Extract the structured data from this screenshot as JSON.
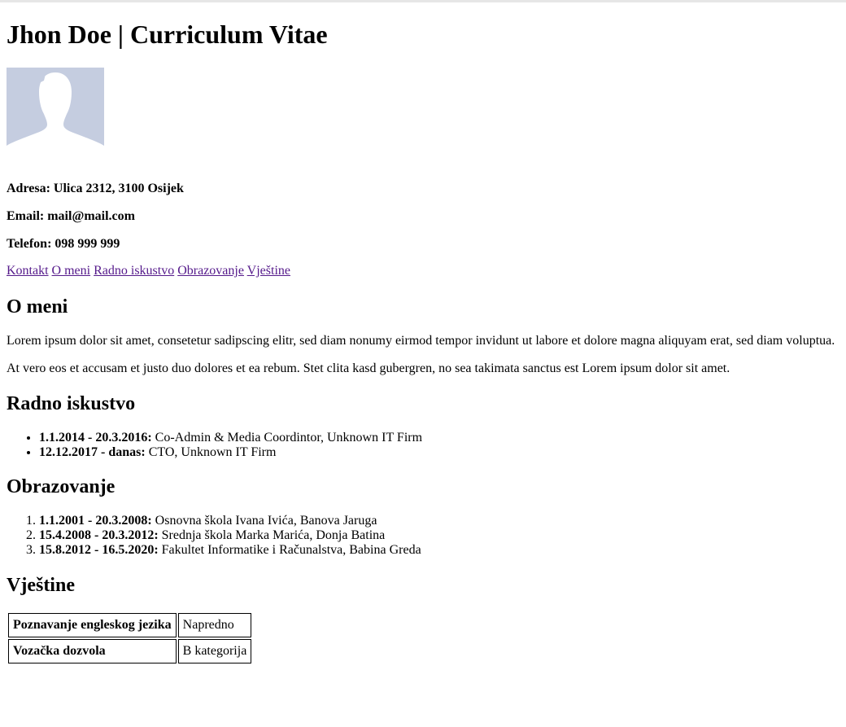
{
  "header": {
    "title": "Jhon Doe | Curriculum Vitae"
  },
  "avatar": {
    "icon": "person-silhouette-icon",
    "bg_color": "#c5cde0"
  },
  "contact": {
    "address": "Adresa: Ulica 2312, 3100 Osijek",
    "email": "Email: mail@mail.com",
    "phone": "Telefon: 098 999 999"
  },
  "nav": {
    "items": [
      {
        "label": "Kontakt"
      },
      {
        "label": "O meni"
      },
      {
        "label": "Radno iskustvo"
      },
      {
        "label": "Obrazovanje"
      },
      {
        "label": "Vještine"
      }
    ],
    "link_color": "#551a8b"
  },
  "about": {
    "heading": "O meni",
    "paragraphs": [
      "Lorem ipsum dolor sit amet, consetetur sadipscing elitr, sed diam nonumy eirmod tempor invidunt ut labore et dolore magna aliquyam erat, sed diam voluptua.",
      "At vero eos et accusam et justo duo dolores et ea rebum. Stet clita kasd gubergren, no sea takimata sanctus est Lorem ipsum dolor sit amet."
    ]
  },
  "work": {
    "heading": "Radno iskustvo",
    "items": [
      {
        "period": "1.1.2014 - 20.3.2016:",
        "text": " Co-Admin & Media Coordintor, Unknown IT Firm"
      },
      {
        "period": "12.12.2017 - danas:",
        "text": " CTO, Unknown IT Firm"
      }
    ]
  },
  "education": {
    "heading": "Obrazovanje",
    "items": [
      {
        "period": "1.1.2001 - 20.3.2008:",
        "text": " Osnovna škola Ivana Ivića, Banova Jaruga"
      },
      {
        "period": "15.4.2008 - 20.3.2012:",
        "text": " Srednja škola Marka Marića, Donja Batina"
      },
      {
        "period": "15.8.2012 - 16.5.2020:",
        "text": " Fakultet Informatike i Računalstva, Babina Greda"
      }
    ]
  },
  "skills": {
    "heading": "Vještine",
    "rows": [
      {
        "key": "Poznavanje engleskog jezika",
        "value": "Napredno"
      },
      {
        "key": "Vozačka dozvola",
        "value": "B kategorija"
      }
    ]
  }
}
